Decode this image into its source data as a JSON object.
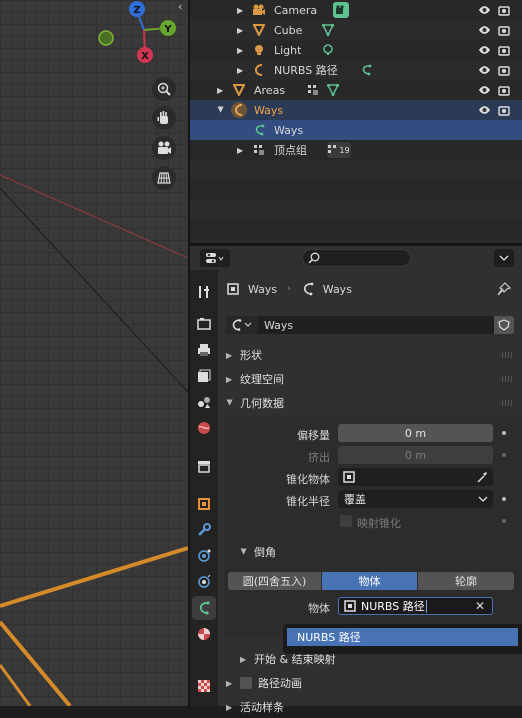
{
  "outliner": {
    "rows": [
      {
        "label": "Camera",
        "icon": "camera-icon"
      },
      {
        "label": "Cube",
        "icon": "mesh-icon"
      },
      {
        "label": "Light",
        "icon": "light-icon"
      },
      {
        "label": "NURBS 路径",
        "icon": "curve-icon"
      },
      {
        "label": "Areas",
        "icon": "mesh-icon"
      },
      {
        "label": "Ways",
        "icon": "curve-icon"
      },
      {
        "label": "Ways",
        "icon": "curve-data-icon"
      },
      {
        "label": "顶点组",
        "icon": "vertex-group-icon",
        "badge": "19"
      }
    ]
  },
  "props": {
    "breadcrumb": {
      "object": "Ways",
      "data": "Ways"
    },
    "datablock_name": "Ways",
    "panels": {
      "shape": "形状",
      "texture_space": "纹理空间",
      "geometry": "几何数据",
      "bevel": "倒角",
      "start_end": "开始 & 结束映射",
      "path_anim": "路径动画",
      "active_spline": "活动样条"
    },
    "geometry": {
      "offset_label": "偏移量",
      "offset_value": "0 m",
      "extrude_label": "挤出",
      "extrude_value": "0 m",
      "taper_obj_label": "锥化物体",
      "taper_radius_label": "锥化半径",
      "taper_radius_value": "覆盖",
      "map_taper_label": "映射锥化"
    },
    "bevel": {
      "modes": [
        "圆(四舍五入)",
        "物体",
        "轮廓"
      ],
      "active_mode": 1,
      "object_label": "物体",
      "object_value": "NURBS 路径"
    }
  },
  "popup": {
    "item": "NURBS 路径"
  },
  "colors": {
    "selection": "#334d80",
    "accent": "#4772b3",
    "curve_orange": "#d89a45",
    "green_icon": "#5fc28f"
  }
}
